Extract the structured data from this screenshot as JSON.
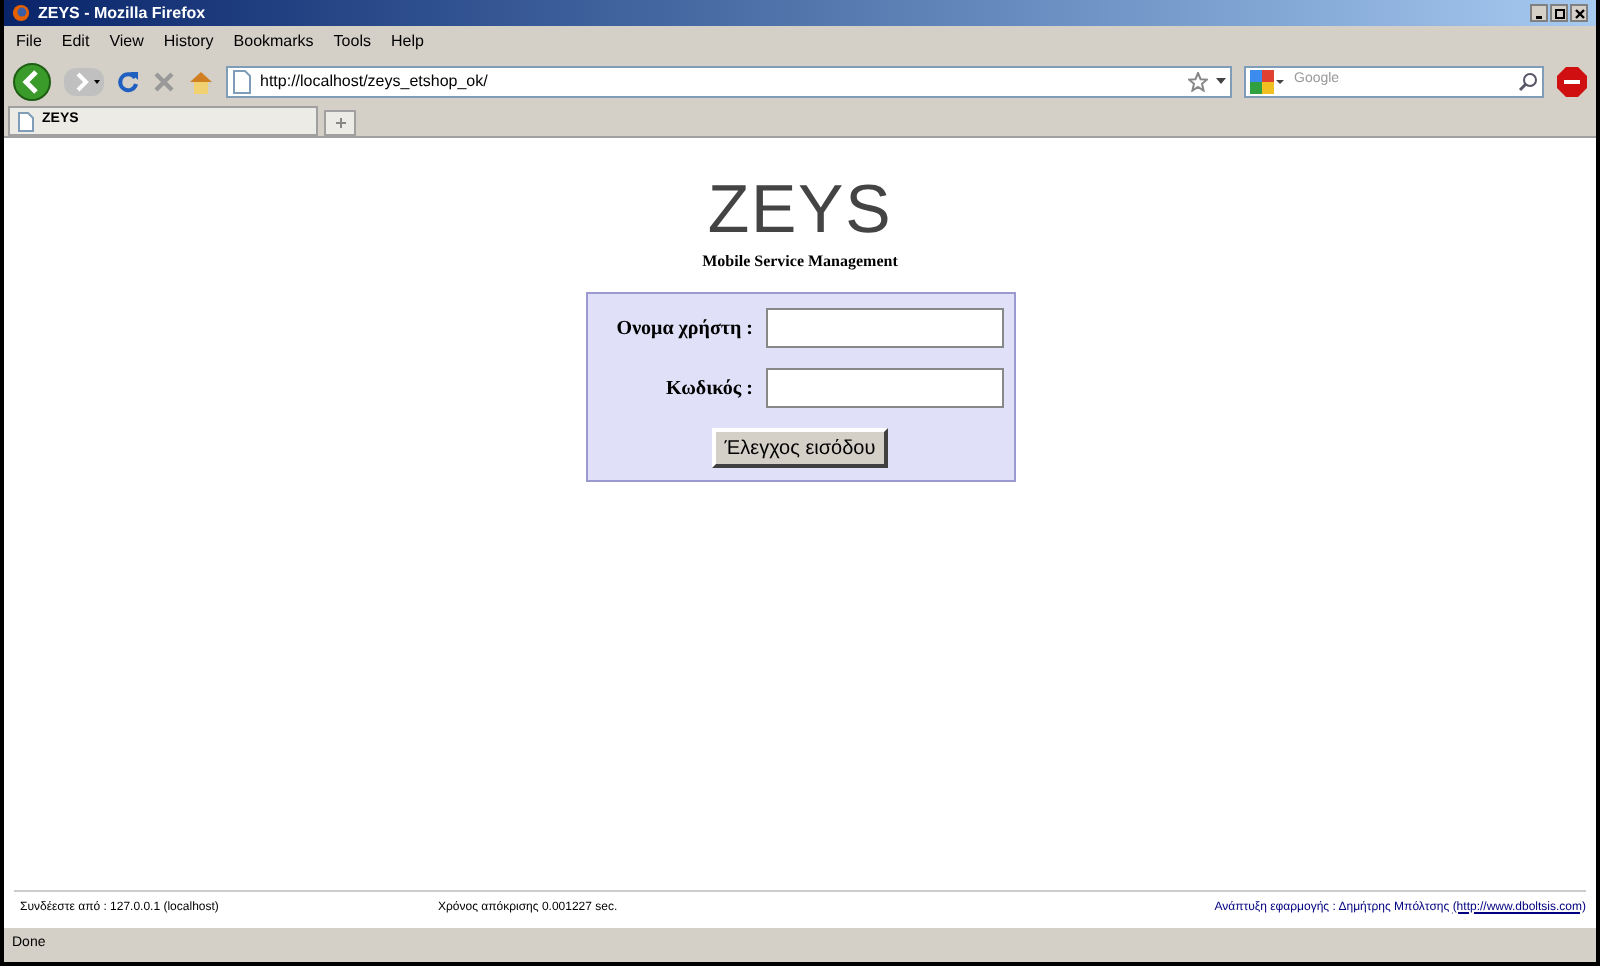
{
  "window": {
    "title": "ZEYS - Mozilla Firefox"
  },
  "menu": [
    "File",
    "Edit",
    "View",
    "History",
    "Bookmarks",
    "Tools",
    "Help"
  ],
  "address": {
    "value": "http://localhost/zeys_etshop_ok/"
  },
  "search": {
    "placeholder": "Google"
  },
  "tabs": [
    {
      "label": "ZEYS",
      "selected": true
    }
  ],
  "page": {
    "logo": "ZEYS",
    "subtitle": "Mobile Service Management",
    "fields": [
      {
        "label": "Ονομα χρήστη :"
      },
      {
        "label": "Κωδικός :"
      }
    ],
    "submit": "Έλεγχος εισόδου",
    "footer": {
      "connected": "Συνδέεστε από : 127.0.0.1 (localhost)",
      "response": "Χρόνος απόκρισης 0.001227 sec.",
      "credit": "Ανάπτυξη εφαρμογής : Δημήτρης Μπόλτσης",
      "link": "(http://www.dboltsis.com)"
    }
  },
  "status_bar": {
    "text": "Done"
  }
}
